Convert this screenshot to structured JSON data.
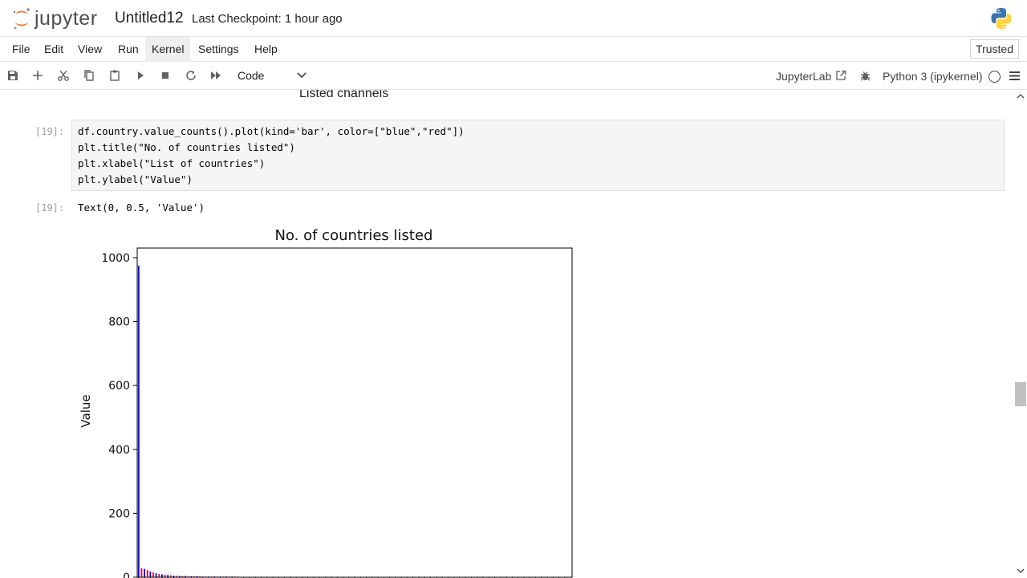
{
  "header": {
    "logo_text": "jupyter",
    "notebook_title": "Untitled12",
    "checkpoint": "Last Checkpoint: 1 hour ago"
  },
  "menu": {
    "items": [
      "File",
      "Edit",
      "View",
      "Run",
      "Kernel",
      "Settings",
      "Help"
    ],
    "active": "Kernel",
    "trusted": "Trusted"
  },
  "toolbar": {
    "cell_type": "Code",
    "jupyterlab_label": "JupyterLab",
    "kernel_name": "Python 3 (ipykernel)"
  },
  "notebook": {
    "prev_output_text": "Listed channels",
    "cell": {
      "input_prompt": "[19]:",
      "output_prompt": "[19]:",
      "code_lines": [
        "df.country.value_counts().plot(kind='bar', color=[\"blue\",\"red\"])",
        "plt.title(\"No. of countries listed\")",
        "plt.xlabel(\"List of countries\")",
        "plt.ylabel(\"Value\")"
      ],
      "output_text": "Text(0, 0.5, 'Value')"
    }
  },
  "colors": {
    "bar_blue": "#0000ff",
    "bar_red": "#ff0000",
    "accent_orange": "#f37726"
  },
  "chart_data": {
    "type": "bar",
    "title": "No. of countries listed",
    "ylabel": "Value",
    "xlabel": "",
    "ylim": [
      0,
      1030
    ],
    "yticks": [
      0,
      200,
      400,
      600,
      800,
      1000
    ],
    "bar_colors": [
      "#0000ff",
      "#ff0000"
    ],
    "values": [
      975,
      28,
      26,
      22,
      18,
      15,
      12,
      10,
      9,
      8,
      7,
      6,
      5,
      5,
      4,
      4,
      4,
      3,
      3,
      3,
      3,
      3,
      2,
      2,
      2,
      2,
      2,
      2,
      2,
      2,
      2,
      2,
      2,
      2,
      1,
      1,
      1,
      1,
      1,
      1,
      1,
      1,
      1,
      1,
      1,
      1,
      1,
      1,
      1,
      1,
      1,
      1,
      1,
      1,
      1,
      1,
      1,
      1,
      1,
      1,
      1,
      1,
      1,
      1,
      1,
      1,
      1,
      1,
      1,
      1,
      1,
      1,
      1,
      1,
      1,
      1,
      1,
      1,
      1,
      1,
      1,
      1,
      1,
      1,
      1,
      1,
      1,
      1,
      1,
      1,
      1,
      1,
      1,
      1,
      1,
      1,
      1,
      1,
      1,
      1,
      1,
      1,
      1,
      1,
      1,
      1,
      1,
      1,
      1,
      1,
      1,
      1,
      1,
      1,
      1,
      1,
      1,
      1,
      1,
      1,
      1,
      1,
      1,
      1,
      1,
      1,
      1,
      1,
      1,
      1,
      1,
      1,
      1,
      1,
      1,
      1,
      1,
      1,
      1,
      1,
      1,
      1,
      1,
      1,
      1,
      1,
      1,
      1,
      1
    ]
  }
}
